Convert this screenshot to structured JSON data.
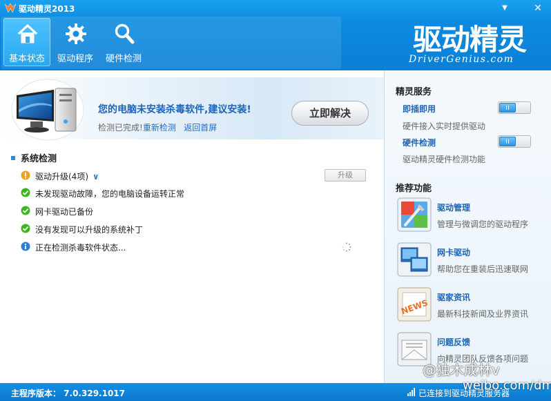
{
  "window": {
    "title": "驱动精灵2013",
    "minimize_glyph": "▼",
    "close_glyph": "✕"
  },
  "nav": {
    "tabs": [
      {
        "label": "基本状态",
        "icon": "home-icon"
      },
      {
        "label": "驱动程序",
        "icon": "gear-icon"
      },
      {
        "label": "硬件检测",
        "icon": "magnifier-icon"
      }
    ]
  },
  "brand": {
    "logo_text": "驱动精灵",
    "subtitle": "DriverGenius.com"
  },
  "banner": {
    "warning": "您的电脑未安装杀毒软件,建议安装!",
    "status_prefix": "检测已完成!",
    "recheck_link": "重新检测",
    "home_link": "返回首屏",
    "fix_button": "立即解决"
  },
  "system_check": {
    "title": "系统检测",
    "items": [
      {
        "type": "warning",
        "text": "驱动升级(4项)",
        "action": "升级"
      },
      {
        "type": "ok",
        "text": "未发现驱动故障，您的电脑设备运转正常"
      },
      {
        "type": "ok",
        "text": "网卡驱动已备份"
      },
      {
        "type": "ok",
        "text": "没有发现可以升级的系统补丁"
      },
      {
        "type": "info",
        "text": "正在检测杀毒软件状态..."
      }
    ]
  },
  "services": {
    "title": "精灵服务",
    "items": [
      {
        "name": "即插即用",
        "desc": "硬件接入实时提供驱动"
      },
      {
        "name": "硬件检测",
        "desc": "驱动精灵硬件检测功能"
      }
    ]
  },
  "recommend": {
    "title": "推荐功能",
    "items": [
      {
        "name": "驱动管理",
        "desc": "管理与微调您的驱动程序",
        "icon": "tools-icon"
      },
      {
        "name": "网卡驱动",
        "desc": "帮助您在重装后迅速联网",
        "icon": "network-icon"
      },
      {
        "name": "驱家资讯",
        "desc": "最新科技新闻及业界资讯",
        "icon": "news-icon",
        "badge": "NEWS"
      },
      {
        "name": "问题反馈",
        "desc": "向精灵团队反馈各项问题",
        "icon": "mail-icon"
      }
    ]
  },
  "statusbar": {
    "version": "主程序版本：  7.0.329.1017",
    "connection": "已连接到驱动精灵服务器"
  },
  "watermark": {
    "line1": "@独木成林v",
    "line2": "weibo.com/dmcl"
  },
  "colors": {
    "accent": "#0d8be0",
    "link": "#1f6bc0",
    "ok": "#3cb521",
    "warn": "#f0a020",
    "info": "#2b7fd6"
  }
}
